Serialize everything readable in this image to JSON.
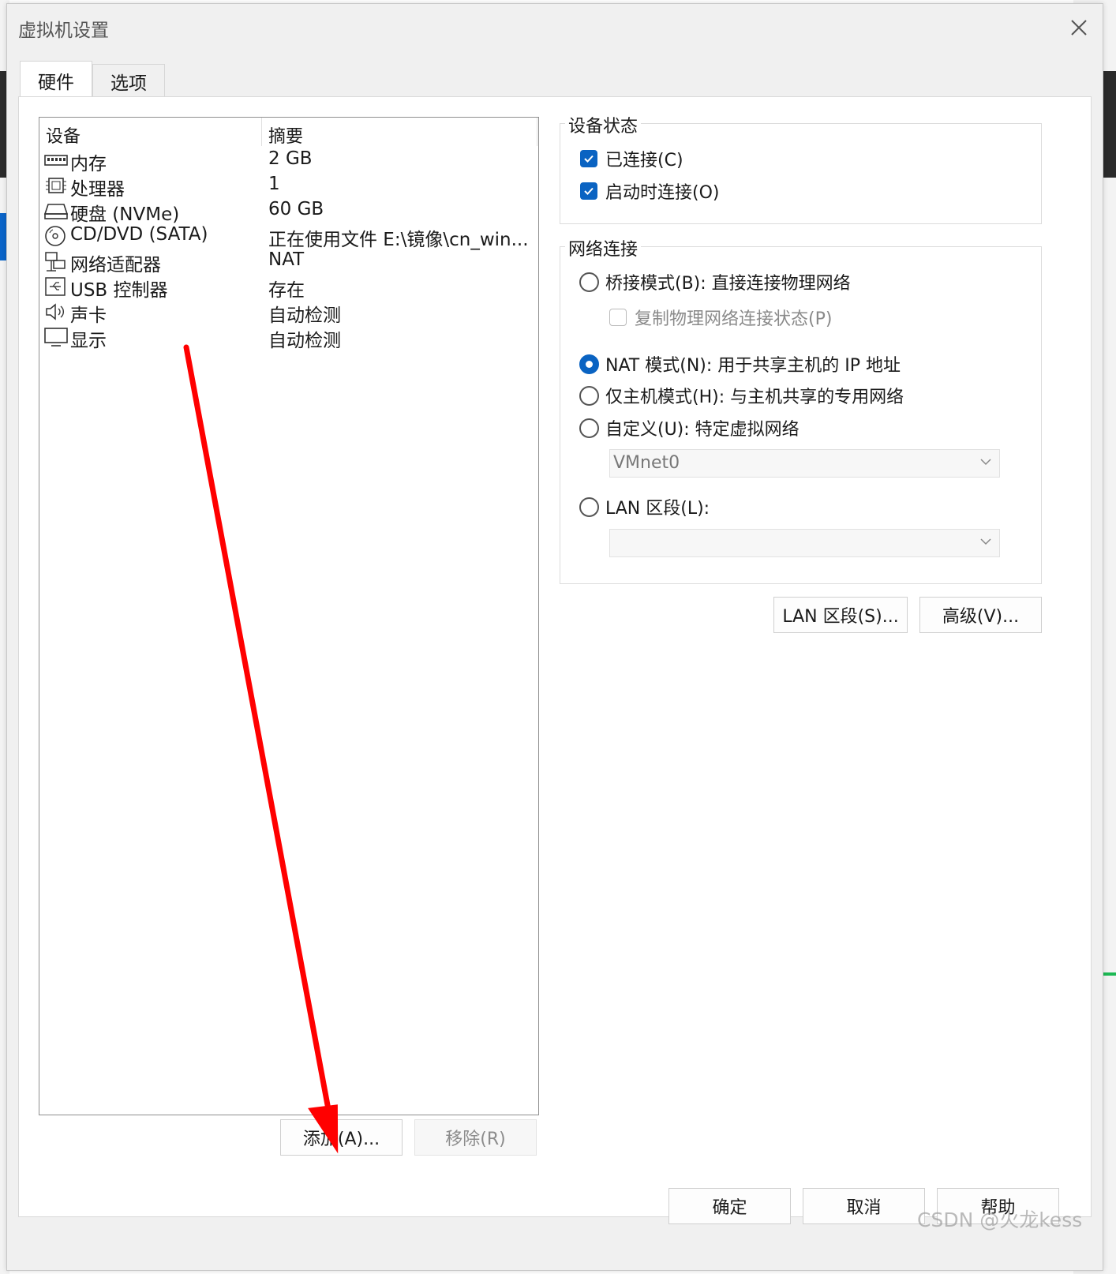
{
  "window": {
    "title": "虚拟机设置"
  },
  "tabs": [
    {
      "label": "硬件"
    },
    {
      "label": "选项"
    }
  ],
  "device_list": {
    "headers": {
      "device": "设备",
      "summary": "摘要"
    },
    "rows": [
      {
        "icon": "memory-icon",
        "name": "内存",
        "summary": "2 GB"
      },
      {
        "icon": "processor-icon",
        "name": "处理器",
        "summary": "1"
      },
      {
        "icon": "hard-disk-icon",
        "name": "硬盘 (NVMe)",
        "summary": "60 GB"
      },
      {
        "icon": "cd-dvd-icon",
        "name": "CD/DVD (SATA)",
        "summary": "正在使用文件 E:\\镜像\\cn_win..."
      },
      {
        "icon": "network-adapter-icon",
        "name": "网络适配器",
        "summary": "NAT"
      },
      {
        "icon": "usb-icon",
        "name": "USB 控制器",
        "summary": "存在"
      },
      {
        "icon": "sound-card-icon",
        "name": "声卡",
        "summary": "自动检测"
      },
      {
        "icon": "display-icon",
        "name": "显示",
        "summary": "自动检测"
      }
    ],
    "add_label": "添加(A)...",
    "remove_label": "移除(R)"
  },
  "device_status": {
    "title": "设备状态",
    "connected": {
      "label": "已连接(C)",
      "checked": true
    },
    "connect_on_start": {
      "label": "启动时连接(O)",
      "checked": true
    }
  },
  "network": {
    "title": "网络连接",
    "bridged": {
      "label": "桥接模式(B): 直接连接物理网络",
      "selected": false
    },
    "replicate": {
      "label": "复制物理网络连接状态(P)",
      "checked": false
    },
    "nat": {
      "label": "NAT 模式(N): 用于共享主机的 IP 地址",
      "selected": true
    },
    "host_only": {
      "label": "仅主机模式(H): 与主机共享的专用网络",
      "selected": false
    },
    "custom": {
      "label": "自定义(U): 特定虚拟网络",
      "selected": false
    },
    "custom_select": "VMnet0",
    "lan": {
      "label": "LAN 区段(L):",
      "selected": false
    },
    "lan_select": "",
    "lan_segments_button": "LAN 区段(S)...",
    "advanced_button": "高级(V)..."
  },
  "footer": {
    "ok": "确定",
    "cancel": "取消",
    "help": "帮助"
  },
  "watermark": "CSDN @火龙kess",
  "colors": {
    "accent": "#0a63c2",
    "annotation_arrow": "#ff0000"
  }
}
